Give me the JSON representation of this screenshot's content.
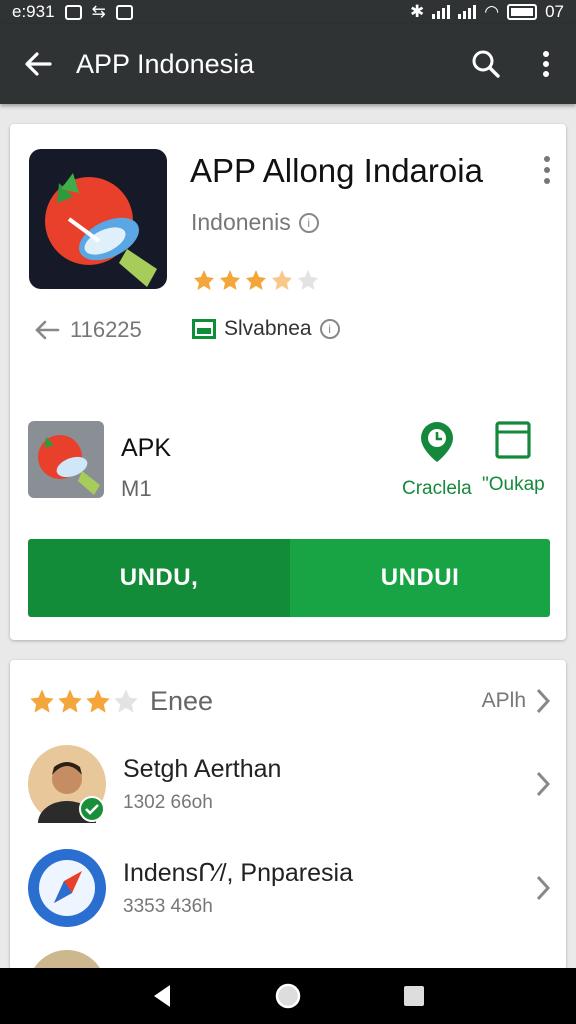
{
  "status_bar": {
    "time": "e:931",
    "battery_text": "07"
  },
  "app_bar": {
    "title": "APP Indonesia"
  },
  "app": {
    "title": "APP  Allong Indaroia",
    "country": "Indonenis",
    "rating_stars": 3.5,
    "downloads": "116225",
    "publisher": "Slvabnea"
  },
  "apk": {
    "label": "APK",
    "size": "M1",
    "actions": [
      "Craclela",
      "\"Oukap"
    ]
  },
  "download_buttons": [
    "UNDU,",
    "UNDUI"
  ],
  "reviews": {
    "stars": 3.5,
    "label": "Enee",
    "more_label": "APlh",
    "items": [
      {
        "name": "Setgh Aerthan",
        "sub": "1302 66oh"
      },
      {
        "name": "IndensՐ⁄/, Pnparesia",
        "sub": "3353 436h"
      }
    ]
  },
  "colors": {
    "bar": "#2f3334",
    "green_dark": "#138c39",
    "green_light": "#18a444",
    "star": "#f4a63a"
  }
}
